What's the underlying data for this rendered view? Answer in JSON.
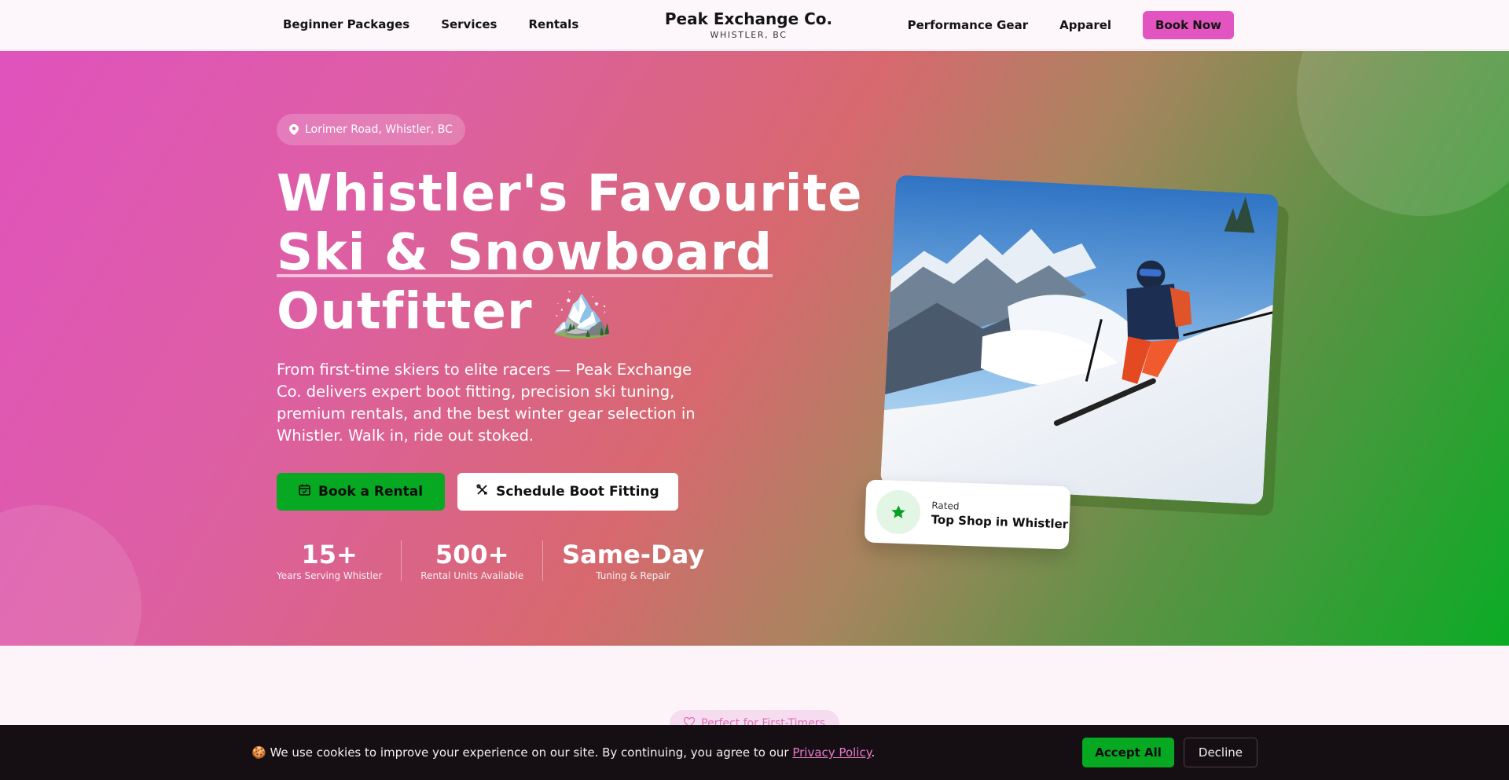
{
  "nav": {
    "left_links": [
      "Beginner Packages",
      "Services",
      "Rentals"
    ],
    "brand_name": "Peak Exchange Co.",
    "brand_sub": "WHISTLER, BC",
    "right_links": [
      "Performance Gear",
      "Apparel"
    ],
    "book_now": "Book Now"
  },
  "hero": {
    "location": "Lorimer Road, Whistler, BC",
    "headline_1": "Whistler's Favourite",
    "headline_2": "Ski & Snowboard",
    "headline_3": "Outfitter",
    "headline_emoji": "🏔️",
    "lead": "From first-time skiers to elite racers — Peak Exchange Co. delivers expert boot fitting, precision ski tuning, premium rentals, and the best winter gear selection in Whistler. Walk in, ride out stoked.",
    "cta_primary": "Book a Rental",
    "cta_secondary": "Schedule Boot Fitting",
    "stats": [
      {
        "value": "15+",
        "label": "Years Serving Whistler"
      },
      {
        "value": "500+",
        "label": "Rental Units Available"
      },
      {
        "value": "Same-Day",
        "label": "Tuning & Repair"
      }
    ],
    "rated_small": "Rated",
    "rated_big": "Top Shop in Whistler"
  },
  "section": {
    "pill": "Perfect for First-Timers"
  },
  "cookie": {
    "emoji": "🍪",
    "text": "We use cookies to improve your experience on our site. By continuing, you agree to our",
    "link": "Privacy Policy",
    "period": ".",
    "accept": "Accept All",
    "decline": "Decline"
  },
  "colors": {
    "accent_pink": "#e255c0",
    "accent_green": "#07a822",
    "cookie_bg": "#150f14"
  },
  "icons": {
    "location": "map-pin-icon",
    "rental": "calendar-icon",
    "boot_fitting": "tools-icon",
    "rated": "star-icon",
    "pill": "heart-icon"
  }
}
